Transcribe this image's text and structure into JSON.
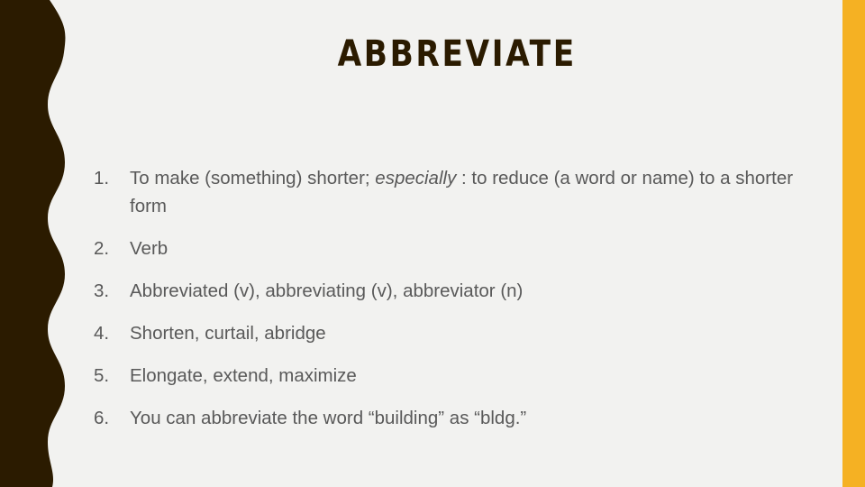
{
  "slide": {
    "title": "ABBREVIATE",
    "background_color": "#f2f2f0",
    "accent_colors": {
      "band_dark_brown": "#2b1b00",
      "bar_amber": "#f5b123",
      "title_text": "#2b1b00",
      "body_text": "#595959"
    }
  },
  "definitions": [
    {
      "number": "1.",
      "pre": "To make (something) shorter; ",
      "emphasis": "especially",
      "post": " : to reduce (a word or name) to a shorter form"
    },
    {
      "number": "2.",
      "pre": "Verb",
      "emphasis": "",
      "post": ""
    },
    {
      "number": "3.",
      "pre": "Abbreviated (v), abbreviating (v), abbreviator (n)",
      "emphasis": "",
      "post": ""
    },
    {
      "number": "4.",
      "pre": "Shorten, curtail, abridge",
      "emphasis": "",
      "post": ""
    },
    {
      "number": "5.",
      "pre": "Elongate, extend, maximize",
      "emphasis": "",
      "post": ""
    },
    {
      "number": "6.",
      "pre": "You can abbreviate the word “building” as “bldg.”",
      "emphasis": "",
      "post": ""
    }
  ]
}
